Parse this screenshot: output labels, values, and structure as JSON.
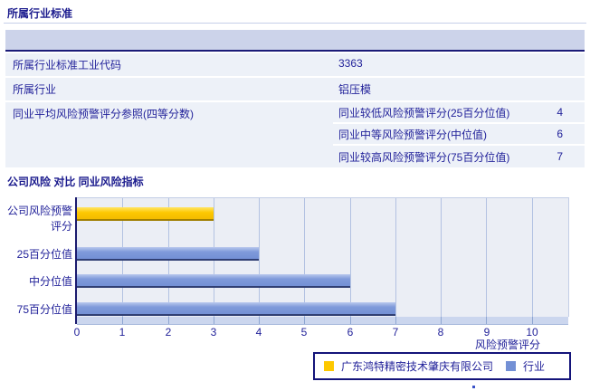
{
  "sections": {
    "industry_standard_title": "所属行业标准",
    "comparison_title": "公司风险 对比 同业风险指标"
  },
  "table": {
    "rows": [
      {
        "label": "所属行业标准工业代码",
        "value": "3363"
      },
      {
        "label": "所属行业",
        "value": "铝压模"
      },
      {
        "label": "同业平均风险预警评分参照(四等分数)",
        "sub_rows": [
          {
            "label": "同业较低风险预警评分(25百分位值)",
            "value": "4"
          },
          {
            "label": "同业中等风险预警评分(中位值)",
            "value": "6"
          },
          {
            "label": "同业较高风险预警评分(75百分位值)",
            "value": "7"
          }
        ]
      }
    ]
  },
  "chart_data": {
    "type": "bar",
    "orientation": "horizontal",
    "title": "公司风险 对比 同业风险指标",
    "categories": [
      "公司风险预警评分",
      "25百分位值",
      "中分位值",
      "75百分位值"
    ],
    "series": [
      {
        "name": "广东鸿特精密技术肇庆有限公司",
        "color": "#fdc800",
        "categories": [
          "公司风险预警评分"
        ],
        "values": [
          3
        ]
      },
      {
        "name": "行业",
        "color": "#7390d5",
        "categories": [
          "25百分位值",
          "中分位值",
          "75百分位值"
        ],
        "values": [
          4,
          6,
          7
        ]
      }
    ],
    "xlabel": "风险预警评分",
    "xticks": [
      0,
      1,
      2,
      3,
      4,
      5,
      6,
      7,
      8,
      9,
      10
    ],
    "xlim": [
      0,
      10.8
    ],
    "grid": "vertical",
    "legend_position": "bottom-right",
    "plot_bg": "#ebeef5",
    "gridline_color": "#b3c2e2"
  },
  "colors": {
    "text_navy": "#22229a",
    "table_header_bg": "#ccd3ea",
    "table_row_bg": "#edf1f8",
    "header_border": "#1b1b78",
    "company_bar": "#fdc800",
    "industry_bar": "#7390d5"
  }
}
